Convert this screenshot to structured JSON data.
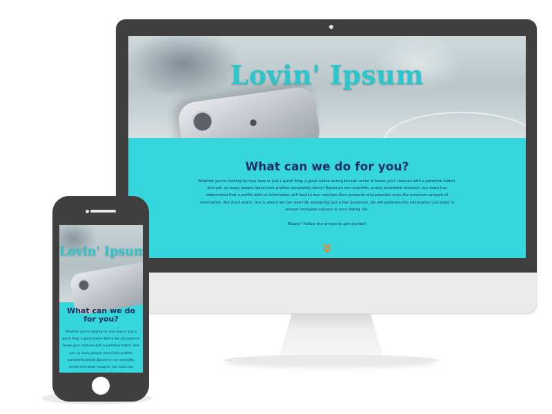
{
  "site": {
    "title": "Lovin' Ipsum",
    "heading": "What can we do for you?",
    "body": "Whether you're looking for true love or just a quick fling, a good online dating bio can make or break your chances with a potential match. And yet, so many people leave their profiles completely blank! Based on non-scientific, purely anecdotal research, our team has determined that a profile with no information will lead to less matches than someone who provides even the minimum amount of information. But don't worry, this is where we can help! By answering just a few questions, we will generate the information you need to ensure increased success in your dating life.",
    "cta": "Ready? Follow the arrows to get started!"
  },
  "phone_view": {
    "title": "Lovin' Ipsum",
    "heading": "What can we do for you?",
    "body": "Whether you're looking for true love or just a quick fling, a good online dating bio can make or break your chances with a potential match. And yet, so many people leave their profiles completely blank! Based on non-scientific, purely anecdotal research, our team has determined that a profile with no"
  },
  "colors": {
    "accent": "#35d6dc",
    "title": "#2ac6cc",
    "text": "#1d3160",
    "arrow": "#e8862a",
    "device": "#3f3f3f"
  },
  "icons": {
    "scroll_arrow": "double-chevron-down-icon",
    "apple_logo": "apple-icon"
  }
}
